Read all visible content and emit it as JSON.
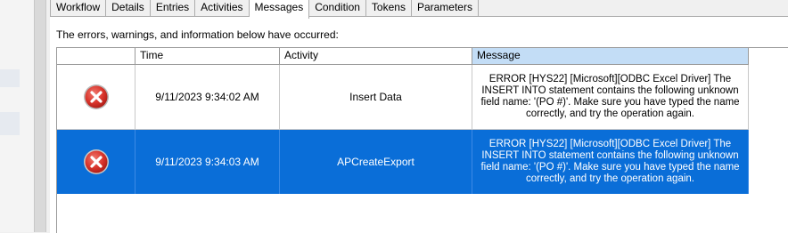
{
  "tabs": [
    {
      "label": "Workflow"
    },
    {
      "label": "Details"
    },
    {
      "label": "Entries"
    },
    {
      "label": "Activities"
    },
    {
      "label": "Messages"
    },
    {
      "label": "Condition"
    },
    {
      "label": "Tokens"
    },
    {
      "label": "Parameters"
    }
  ],
  "active_tab": "Messages",
  "notice": "The errors, warnings, and information below have occurred:",
  "grid": {
    "columns": [
      "",
      "Time",
      "Activity",
      "Message"
    ],
    "rows": [
      {
        "icon": "error-icon",
        "time": "9/11/2023 9:34:02 AM",
        "activity": "Insert Data",
        "message": "ERROR [HYS22] [Microsoft][ODBC Excel Driver] The INSERT INTO statement contains the following unknown field name: '(PO #)'. Make sure you have typed the name correctly, and try the operation again.",
        "selected": false
      },
      {
        "icon": "error-icon",
        "time": "9/11/2023 9:34:03 AM",
        "activity": "APCreateExport",
        "message": "ERROR [HYS22] [Microsoft][ODBC Excel Driver] The INSERT INTO statement contains the following unknown field name: '(PO #)'. Make sure you have typed the name correctly, and try the operation again.",
        "selected": true
      }
    ]
  },
  "colors": {
    "selected_row": "#0a6ed8",
    "message_header": "#c3ddf6",
    "error_red": "#d9342b"
  }
}
